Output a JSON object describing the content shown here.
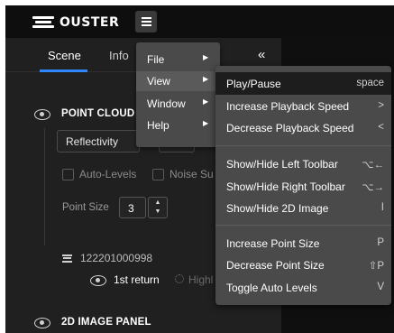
{
  "header": {
    "logo_text": "OUSTER",
    "logo_mark": "ouster-logo",
    "menu_icon": "hamburger-icon"
  },
  "panel": {
    "tabs": [
      {
        "label": "Scene",
        "active": true
      },
      {
        "label": "Info",
        "active": false
      }
    ],
    "collapse_label": "«",
    "point_cloud": {
      "title": "POINT CLOUD",
      "color_mode": "Reflectivity",
      "auto_levels_label": "Auto-Levels",
      "noise_label": "Noise Su",
      "point_size_label": "Point Size",
      "point_size_value": "3",
      "stepper_up": "▲",
      "stepper_down": "▼",
      "sensor_serial": "122201000998",
      "return_label": "1st return",
      "highlight_label": "Highl"
    },
    "image_panel": {
      "title": "2D IMAGE PANEL"
    }
  },
  "menu": {
    "items": [
      {
        "label": "File",
        "arrow": "▶"
      },
      {
        "label": "View",
        "arrow": "▶"
      },
      {
        "label": "Window",
        "arrow": "▶"
      },
      {
        "label": "Help",
        "arrow": "▶"
      }
    ]
  },
  "submenu": {
    "items": [
      {
        "label": "Play/Pause",
        "key": "space"
      },
      {
        "label": "Increase Playback Speed",
        "key": ">"
      },
      {
        "label": "Decrease Playback Speed",
        "key": "<"
      },
      {
        "label": "Show/Hide Left Toolbar",
        "key": "⌥←"
      },
      {
        "label": "Show/Hide Right Toolbar",
        "key": "⌥→"
      },
      {
        "label": "Show/Hide 2D Image",
        "key": "I"
      },
      {
        "label": "Increase Point Size",
        "key": "P"
      },
      {
        "label": "Decrease Point Size",
        "key": "⇧P"
      },
      {
        "label": "Toggle Auto Levels",
        "key": "V"
      }
    ]
  },
  "colors": {
    "accent": "#2f86ff",
    "background": "#1a1a1a",
    "menu_bg": "#4a4a4a",
    "menu_highlight": "#1d1d1d"
  }
}
